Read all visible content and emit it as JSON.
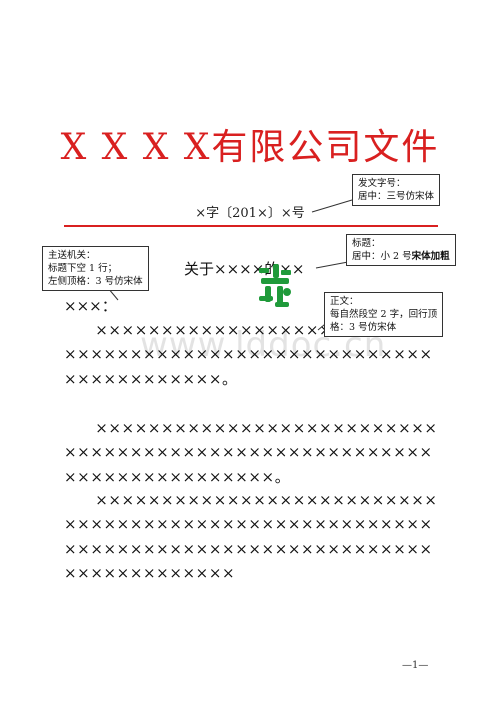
{
  "header": {
    "title": "X X X X有限公司文件"
  },
  "doc_number": "×字〔201×〕×号",
  "callouts": {
    "doc_number_note": {
      "line1": "发文字号：",
      "line2": "居中：三号仿宋体"
    },
    "title_note": {
      "line1": "标题：",
      "line2_prefix": "居中：小 2 号",
      "line2_bold": "宋体加粗"
    },
    "addressee_note": {
      "line1": "主送机关：",
      "line2": "标题下空 1 行；",
      "line3": "左侧顶格：3 号仿宋体"
    },
    "body_note": {
      "line1": "正文：",
      "line2": "每自然段空 2 字，回行顶",
      "line3": "格：3 号仿宋体"
    }
  },
  "doc_title": "关于××××的××",
  "addressee": "×××：",
  "paragraphs": [
    "　　××××××××××××××××××××××××××××××××××××××××××××××××××××××××××××××××××。",
    "　　××××××××××××××××××××××××××××××××××××××××××××××××××××××××××××××××××××××。",
    "　　×××××××××××××××××××××××××××××××××××××××××××××××××××××××××××××××××××××××××××××××××××××××××××××××"
  ],
  "watermark": "www.lddoc.cn",
  "page_number": "—1—",
  "colors": {
    "red": "#d92020",
    "stamp_green": "#1f9a3a"
  }
}
